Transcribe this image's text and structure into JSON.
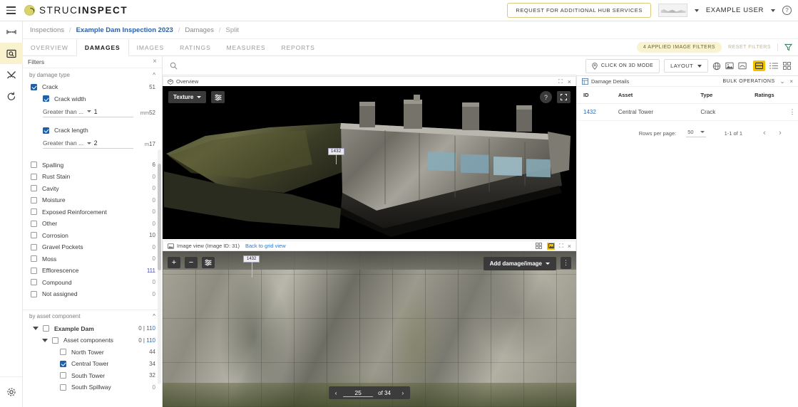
{
  "brand": {
    "name_light": "STRUC",
    "name_bold": "INSPECT",
    "logo_icon": "s-circle-logo"
  },
  "topbar": {
    "menu_icon": "hamburger-icon",
    "hub_button": "REQUEST FOR ADDITIONAL HUB SERVICES",
    "asset_thumb_icon": "dam-thumbnail-icon",
    "asset_caret_icon": "chevron-down-icon",
    "user": "EXAMPLE USER",
    "user_caret_icon": "chevron-down-icon",
    "help_icon": "help-circle-icon"
  },
  "rail": {
    "items": [
      {
        "name": "assets",
        "icon": "bridge-icon",
        "active": false
      },
      {
        "name": "inspections",
        "icon": "image-search-icon",
        "active": true
      },
      {
        "name": "tools",
        "icon": "tools-icon",
        "active": false
      },
      {
        "name": "refresh",
        "icon": "refresh-icon",
        "active": false
      }
    ],
    "bottom": {
      "name": "settings",
      "icon": "gear-icon"
    }
  },
  "breadcrumb": {
    "items": [
      "Inspections",
      "Example Dam Inspection 2023",
      "Damages",
      "Split"
    ],
    "separator": "/"
  },
  "tabs": {
    "items": [
      "OVERVIEW",
      "DAMAGES",
      "IMAGES",
      "RATINGS",
      "MEASURES",
      "REPORTS"
    ],
    "active": "DAMAGES",
    "applied_filters": "4 APPLIED IMAGE FILTERS",
    "reset_filters": "RESET FILTERS",
    "filter_icon": "funnel-icon"
  },
  "filters": {
    "title": "Filters",
    "close_icon": "close-icon",
    "group_damage_type": {
      "label": "by damage type",
      "collapse_icon": "chevron-up-icon",
      "rows": [
        {
          "label": "Crack",
          "count": "51",
          "checked": true,
          "indent": 0
        }
      ],
      "crack_width": {
        "label": "Crack width",
        "checked": true,
        "operator": "Greater than ...",
        "value": "1",
        "unit": "mm",
        "count": "52"
      },
      "crack_length": {
        "label": "Crack length",
        "checked": true,
        "operator": "Greater than ...",
        "value": "2",
        "unit": "m",
        "count": "17"
      },
      "others": [
        {
          "label": "Spalling",
          "count": "6",
          "checked": false
        },
        {
          "label": "Rust Stain",
          "count": "0",
          "checked": false
        },
        {
          "label": "Cavity",
          "count": "0",
          "checked": false
        },
        {
          "label": "Moisture",
          "count": "0",
          "checked": false
        },
        {
          "label": "Exposed Reinforcement",
          "count": "0",
          "checked": false
        },
        {
          "label": "Other",
          "count": "0",
          "checked": false
        },
        {
          "label": "Corrosion",
          "count": "10",
          "checked": false
        },
        {
          "label": "Gravel Pockets",
          "count": "0",
          "checked": false
        },
        {
          "label": "Moss",
          "count": "0",
          "checked": false
        },
        {
          "label": "Efflorescence",
          "count": "111",
          "checked": false
        },
        {
          "label": "Compound",
          "count": "0",
          "checked": false
        },
        {
          "label": "Not assigned",
          "count": "0",
          "checked": false
        }
      ]
    },
    "group_asset_component": {
      "label": "by asset component",
      "collapse_icon": "chevron-up-icon",
      "rows": [
        {
          "label": "Example Dam",
          "count_left": "0",
          "count_right": "110",
          "checked": false,
          "level": 0,
          "expanded": true
        },
        {
          "label": "Asset components",
          "count_left": "0",
          "count_right": "110",
          "checked": false,
          "level": 1,
          "expanded": true
        },
        {
          "label": "North Tower",
          "count": "44",
          "checked": false,
          "level": 2
        },
        {
          "label": "Central Tower",
          "count": "34",
          "checked": true,
          "level": 2
        },
        {
          "label": "South Tower",
          "count": "32",
          "checked": false,
          "level": 2
        },
        {
          "label": "South Spillway",
          "count": "0",
          "checked": false,
          "level": 2
        }
      ]
    }
  },
  "search": {
    "placeholder": "",
    "value": "",
    "icon": "search-icon"
  },
  "toolbar3d": {
    "click_3d_mode": "CLICK ON 3D MODE",
    "pin_icon": "map-pin-icon",
    "layout": "LAYOUT",
    "layout_caret_icon": "chevron-down-icon",
    "icons": [
      {
        "name": "globe-3d-icon",
        "active": false
      },
      {
        "name": "image-icon",
        "active": false
      },
      {
        "name": "panorama-icon",
        "active": false
      }
    ],
    "view_modes": [
      {
        "name": "split-view-icon",
        "active": true
      },
      {
        "name": "list-view-icon",
        "active": false
      },
      {
        "name": "grid-view-icon",
        "active": false
      }
    ]
  },
  "overview_panel": {
    "title": "Overview",
    "title_icon": "cube-3d-icon",
    "expand_icon": "expand-icon",
    "close_icon": "close-icon",
    "texture_button": "Texture",
    "texture_caret_icon": "chevron-down-icon",
    "settings_icon": "sliders-icon",
    "help_icon": "help-circle-icon",
    "fullscreen_icon": "fullscreen-icon",
    "damage_tag": "1432"
  },
  "image_panel": {
    "title": "Image view (Image ID: 31)",
    "title_icon": "image-icon",
    "back_link": "Back to grid view",
    "grid_icon": "grid-icon",
    "single_icon": "single-image-icon",
    "expand_icon": "expand-icon",
    "close_icon": "close-icon",
    "zoom_in_icon": "plus-icon",
    "zoom_out_icon": "minus-icon",
    "adjust_icon": "sliders-icon",
    "add_damage_button": "Add damage/image",
    "add_damage_caret_icon": "chevron-down-icon",
    "more_icon": "kebab-menu-icon",
    "damage_tag": "1432",
    "pager": {
      "prev_icon": "chevron-left-icon",
      "current": "25",
      "of_label": "of 34",
      "next_icon": "chevron-right-icon"
    }
  },
  "damage_details": {
    "title": "Damage Details",
    "title_icon": "table-icon",
    "bulk_operations": "BULK OPERATIONS",
    "caret_icon": "chevron-down-icon",
    "close_icon": "close-icon",
    "columns": [
      "ID",
      "Asset",
      "Type",
      "Ratings"
    ],
    "rows": [
      {
        "id": "1432",
        "asset": "Central Tower",
        "type": "Crack",
        "ratings": "",
        "menu_icon": "kebab-menu-icon"
      }
    ],
    "pagination": {
      "rows_per_page_label": "Rows per page:",
      "rows_per_page_value": "50",
      "range": "1-1 of 1",
      "prev_icon": "chevron-left-icon",
      "next_icon": "chevron-right-icon"
    }
  },
  "colors": {
    "accent_yellow": "#f2c200",
    "pill_yellow": "#faf3cf",
    "link_blue": "#2b6cb8",
    "checkbox_blue": "#1f5fa9"
  }
}
